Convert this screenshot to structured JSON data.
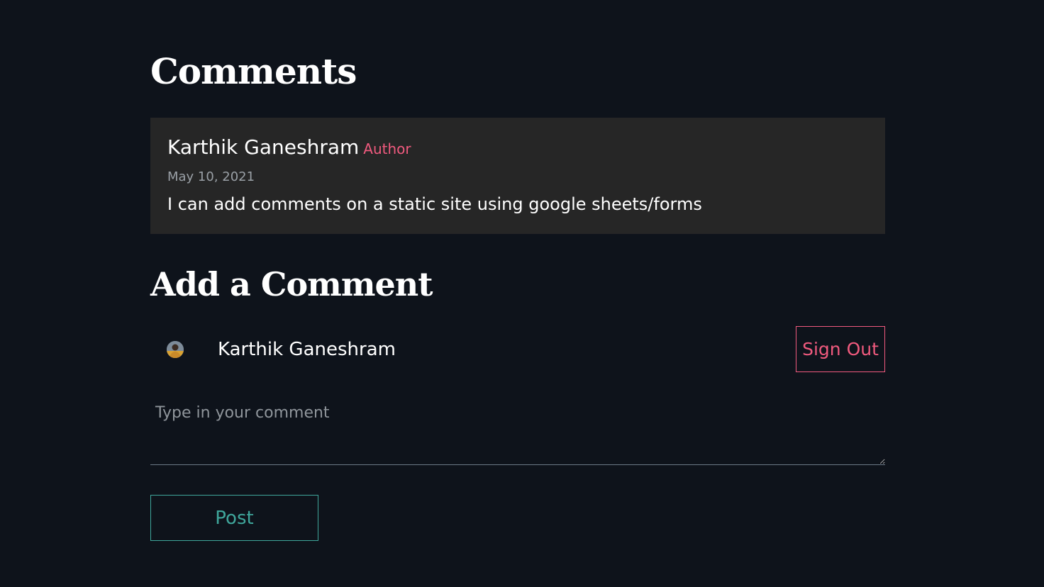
{
  "comments_section": {
    "title": "Comments",
    "comments": [
      {
        "author": "Karthik Ganeshram",
        "badge": "Author",
        "date": "May 10, 2021",
        "text": "I can add comments on a static site using google sheets/forms"
      }
    ]
  },
  "add_comment": {
    "title": "Add a Comment",
    "user_name": "Karthik Ganeshram",
    "avatar_icon": "user-avatar-photo",
    "sign_out_label": "Sign Out",
    "input_placeholder": "Type in your comment",
    "input_value": "",
    "post_label": "Post"
  },
  "colors": {
    "background": "#0e131b",
    "card": "#262626",
    "accent_pink": "#f05a7e",
    "accent_teal": "#3fa69b"
  }
}
